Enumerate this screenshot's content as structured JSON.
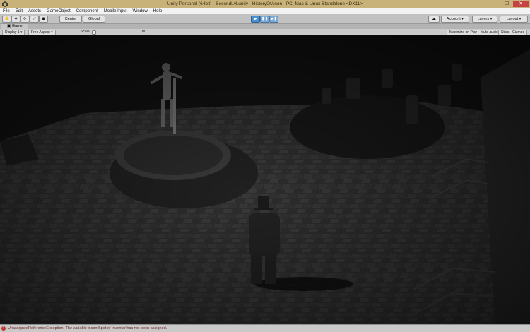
{
  "window": {
    "title": "Unity Personal (64bit) - SecondLvl.unity - HistoryOfAnon - PC, Mac & Linux Standalone <DX11>",
    "minimize": "–",
    "maximize": "☐",
    "close": "✕"
  },
  "menu": [
    "File",
    "Edit",
    "Assets",
    "GameObject",
    "Component",
    "Mobile Input",
    "Window",
    "Help"
  ],
  "toolbar": {
    "pivot": "Center",
    "space": "Global",
    "play_glyph": "▶",
    "pause_glyph": "❚❚",
    "step_glyph": "▶❚",
    "account": "Account",
    "layers": "Layers",
    "layout": "Layout"
  },
  "game_tab": {
    "label": "Game",
    "display": "Display 1",
    "aspect": "Free Aspect",
    "scale_label": "Scale",
    "scale_value": "1x",
    "maximize_on_play": "Maximize on Play",
    "mute_audio": "Mute audio",
    "stats": "Stats",
    "gizmos": "Gizmos"
  },
  "status": {
    "message": "UnassignedReferenceException: The variable incantSpot of Inventar has not been assigned."
  },
  "colors": {
    "titlebar": "#c9b27a",
    "play_active": "#4a8fd0",
    "error": "#c03030"
  }
}
